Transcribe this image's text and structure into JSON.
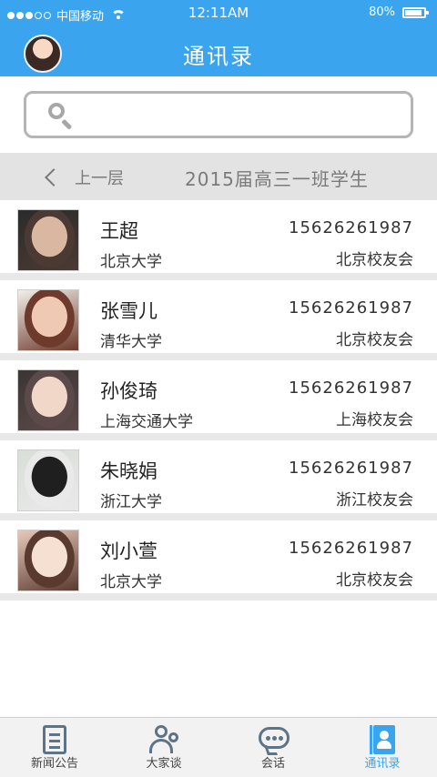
{
  "status_bar": {
    "carrier": "中国移动",
    "time": "12:11AM",
    "battery_text": "80%",
    "battery_level": 0.8
  },
  "header": {
    "title": "通讯录"
  },
  "search": {
    "placeholder": "",
    "value": ""
  },
  "breadcrumb": {
    "back_label": "上一层",
    "title": "2015届高三一班学生"
  },
  "contacts": [
    {
      "name": "王超",
      "school": "北京大学",
      "phone": "15626261987",
      "group": "北京校友会",
      "photo_colors": [
        "#2b2b2b",
        "#d9b7a0",
        "#4a3a33"
      ]
    },
    {
      "name": "张雪儿",
      "school": "清华大学",
      "phone": "15626261987",
      "group": "北京校友会",
      "photo_colors": [
        "#f3efe9",
        "#f0c9b4",
        "#6d3a2b"
      ]
    },
    {
      "name": "孙俊琦",
      "school": "上海交通大学",
      "phone": "15626261987",
      "group": "上海校友会",
      "photo_colors": [
        "#3b3535",
        "#f1d7c7",
        "#5b4a49"
      ]
    },
    {
      "name": "朱晓娟",
      "school": "浙江大学",
      "phone": "15626261987",
      "group": "浙江校友会",
      "photo_colors": [
        "#d9ded9",
        "#1f1f1f",
        "#e9e9e9"
      ]
    },
    {
      "name": "刘小萱",
      "school": "北京大学",
      "phone": "15626261987",
      "group": "北京校友会",
      "photo_colors": [
        "#e8c9b9",
        "#f6e0d2",
        "#5a3a2f"
      ]
    }
  ],
  "tabs": [
    {
      "label": "新闻公告",
      "icon": "news-icon"
    },
    {
      "label": "大家谈",
      "icon": "people-icon"
    },
    {
      "label": "会话",
      "icon": "chat-icon"
    },
    {
      "label": "通讯录",
      "icon": "contacts-icon"
    }
  ],
  "colors": {
    "primary": "#3aa4ee",
    "divider": "#e8e8e8",
    "crumb_bg": "#e3e3e3"
  }
}
